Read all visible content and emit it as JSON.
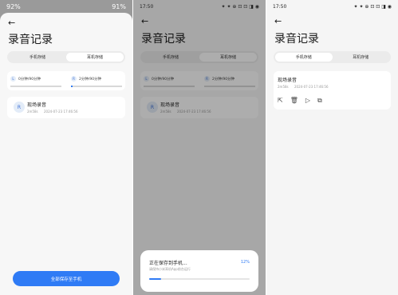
{
  "panel1": {
    "status": {
      "left": "92%",
      "right": "91%"
    },
    "title": "录音记录",
    "tabs": [
      "手机存储",
      "耳机存储"
    ],
    "stats": [
      {
        "badge": "L",
        "text": "0分钟/90分钟"
      },
      {
        "badge": "R",
        "text": "2分钟/90分钟"
      }
    ],
    "record": {
      "avatar": "R",
      "name": "现场录音",
      "duration": "2m58s",
      "date": "2024-07-23 17:46:56"
    },
    "button": "全部保存至手机"
  },
  "panel2": {
    "status": {
      "time": "17:50",
      "icons": "✦ ✦ ⊕ ⊡ ⊡ ◨ ◉"
    },
    "title": "录音记录",
    "tabs": [
      "手机存储",
      "耳机存储"
    ],
    "stats": [
      {
        "badge": "L",
        "text": "0分钟/90分钟"
      },
      {
        "badge": "R",
        "text": "2分钟/90分钟"
      }
    ],
    "record": {
      "avatar": "R",
      "name": "现场录音",
      "duration": "2m58s",
      "date": "2024-07-23 17:46:56"
    },
    "dialog": {
      "title": "正在保存到手机...",
      "subtitle": "请保持小米耳机App前台运行",
      "percent": "12%"
    }
  },
  "panel3": {
    "status": {
      "time": "17:50",
      "icons": "✦ ✦ ⊕ ⊡ ⊡ ◨ ◉"
    },
    "title": "录音记录",
    "tabs": [
      "手机存储",
      "耳机存储"
    ],
    "record": {
      "name": "现场录音",
      "duration": "2m58s",
      "date": "2024-07-23 17:46:56"
    },
    "actions": [
      "share-icon",
      "trash-icon",
      "play-icon",
      "copy-icon"
    ]
  }
}
